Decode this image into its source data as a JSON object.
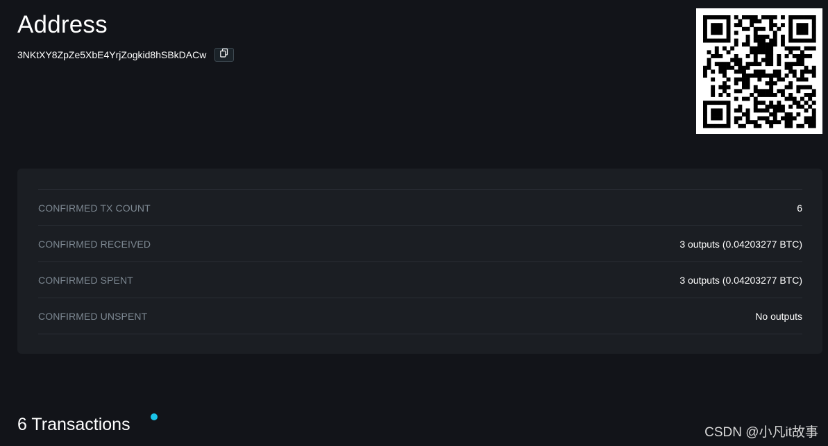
{
  "header": {
    "title": "Address",
    "address": "3NKtXY8ZpZe5XbE4YrjZogkid8hSBkDACw"
  },
  "icons": {
    "copy": "copy-icon",
    "qr": "qr-code"
  },
  "stats": [
    {
      "label": "CONFIRMED TX COUNT",
      "value": "6"
    },
    {
      "label": "CONFIRMED RECEIVED",
      "value": "3 outputs (0.04203277 BTC)"
    },
    {
      "label": "CONFIRMED SPENT",
      "value": "3 outputs (0.04203277 BTC)"
    },
    {
      "label": "CONFIRMED UNSPENT",
      "value": "No outputs"
    }
  ],
  "transactions": {
    "heading": "6 Transactions"
  },
  "watermark": "CSDN @小凡it故事",
  "colors": {
    "background": "#121419",
    "card": "#1b1e23",
    "label": "#7d8892",
    "accent_dot": "#1ac5ea"
  }
}
